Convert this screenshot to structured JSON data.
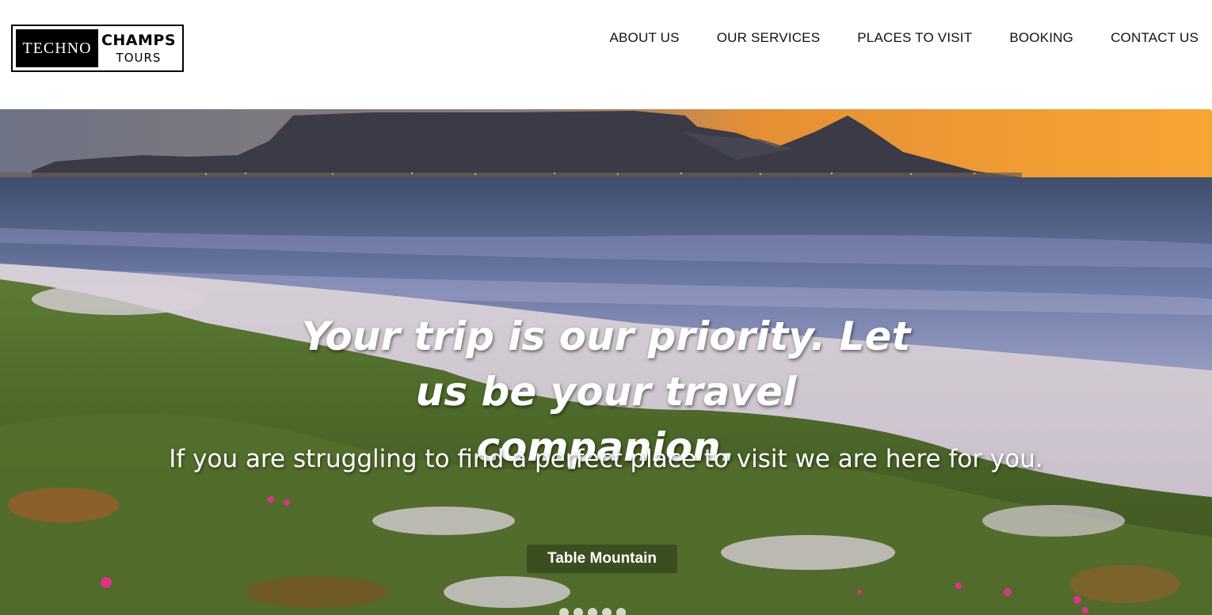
{
  "logo": {
    "dark_text": "TECHNO",
    "bold_text": "CHAMPS",
    "sub_text": "TOURS"
  },
  "nav": {
    "items": [
      {
        "label": "ABOUT US"
      },
      {
        "label": "OUR SERVICES"
      },
      {
        "label": "PLACES TO VISIT"
      },
      {
        "label": "BOOKING"
      },
      {
        "label": "CONTACT US"
      }
    ]
  },
  "hero": {
    "headline": "Your trip is our priority. Let us be your travel companion.",
    "subtext": "If you are struggling to find a perfect place to visit we are here for you.",
    "caption": "Table Mountain",
    "slide_count": 5
  },
  "colors": {
    "sky_sunset": "#f29a2e",
    "sky_dusk": "#7a7f92",
    "sea": "#6f7ea6",
    "sand": "#cfc7d0",
    "grass": "#4f6a2a",
    "nav_text": "#111111"
  }
}
